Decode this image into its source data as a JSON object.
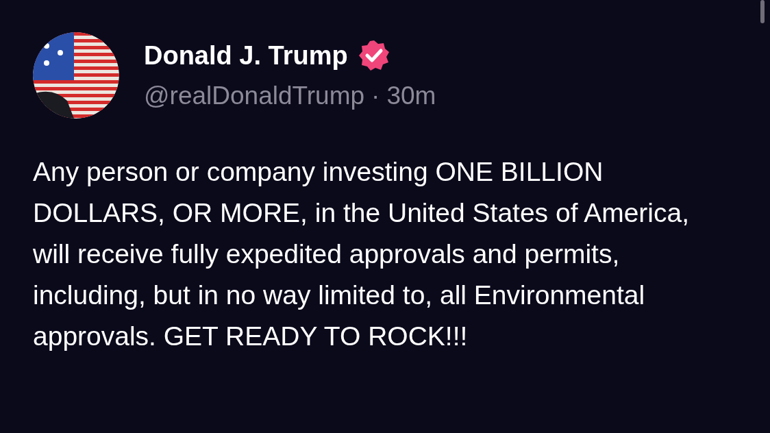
{
  "post": {
    "author": {
      "name": "Donald J. Trump",
      "verified": true
    },
    "handle": "@realDonaldTrump",
    "separator": "·",
    "time": "30m",
    "text": "Any person or company investing ONE BILLION DOLLARS, OR MORE, in the United States of America, will receive fully expedited approvals and permits, including, but in no way limited to, all Environmental approvals. GET READY TO ROCK!!!"
  }
}
